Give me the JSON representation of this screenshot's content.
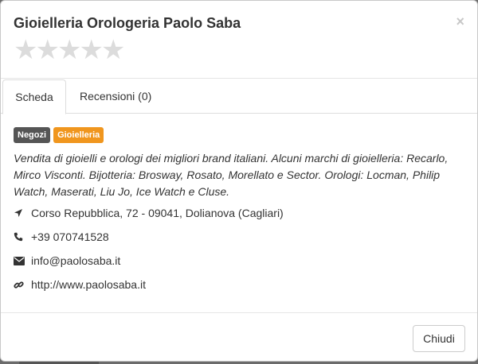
{
  "modal": {
    "title": "Gioielleria Orologeria Paolo Saba",
    "close_glyph": "×",
    "rating": {
      "filled": 0,
      "max": 5,
      "star_glyph": "★"
    }
  },
  "tabs": [
    {
      "label": "Scheda",
      "active": true
    },
    {
      "label": "Recensioni (0)",
      "active": false
    }
  ],
  "badges": [
    {
      "label": "Negozi",
      "color": "#555555"
    },
    {
      "label": "Gioielleria",
      "color": "#f0961e"
    }
  ],
  "description": "Vendita di gioielli e orologi dei migliori brand italiani. Alcuni marchi di gioielleria: Recarlo, Mirco Visconti. Bijotteria: Brosway, Rosato, Morellato e Sector. Orologi: Locman, Philip Watch, Maserati, Liu Jo, Ice Watch e Cluse.",
  "details": {
    "address": {
      "icon": "location-arrow-icon",
      "text": "Corso Repubblica, 72 - 09041, Dolianova (Cagliari)"
    },
    "phone": {
      "icon": "phone-icon",
      "text": "+39 070741528"
    },
    "email": {
      "icon": "envelope-icon",
      "text": "info@paolosaba.it"
    },
    "website": {
      "icon": "link-icon",
      "text": "http://www.paolosaba.it"
    }
  },
  "footer": {
    "close_label": "Chiudi"
  }
}
